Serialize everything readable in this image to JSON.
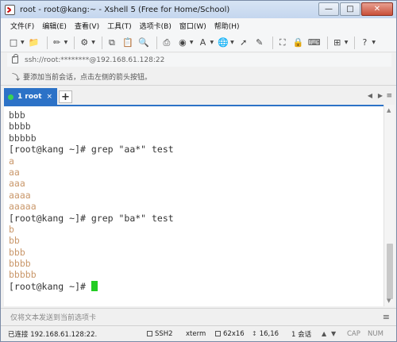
{
  "window": {
    "title": "root - root@kang:~ - Xshell 5 (Free for Home/School)",
    "minimize": "—",
    "maximize": "□",
    "close": "✕"
  },
  "menu": [
    "文件(F)",
    "编辑(E)",
    "查看(V)",
    "工具(T)",
    "选项卡(B)",
    "窗口(W)",
    "帮助(H)"
  ],
  "address": {
    "text": "ssh://root:********@192.168.61.128:22"
  },
  "hint": {
    "text": "要添加当前会话，点击左侧的箭头按钮。"
  },
  "tabs": {
    "active_label": "1 root",
    "close": "×",
    "add": "+",
    "prev": "◀",
    "next": "▶",
    "menu": "≡"
  },
  "terminal": {
    "lines": [
      {
        "text": "bbb",
        "style": "default"
      },
      {
        "text": "bbbb",
        "style": "default"
      },
      {
        "text": "bbbbb",
        "style": "default"
      },
      {
        "text": "[root@kang ~]# grep \"aa*\" test",
        "style": "prompt"
      },
      {
        "text": "a",
        "style": "out"
      },
      {
        "text": "aa",
        "style": "out"
      },
      {
        "text": "aaa",
        "style": "out"
      },
      {
        "text": "aaaa",
        "style": "out"
      },
      {
        "text": "aaaaa",
        "style": "out"
      },
      {
        "text": "[root@kang ~]# grep \"ba*\" test",
        "style": "prompt"
      },
      {
        "text": "b",
        "style": "out"
      },
      {
        "text": "bb",
        "style": "out"
      },
      {
        "text": "bbb",
        "style": "out"
      },
      {
        "text": "bbbb",
        "style": "out"
      },
      {
        "text": "bbbbb",
        "style": "out"
      }
    ],
    "final_prompt": "[root@kang ~]# "
  },
  "sendbar": {
    "placeholder": "仅将文本发送到当前选项卡",
    "menu": "≡"
  },
  "status": {
    "connection": "已连接 192.168.61.128:22.",
    "protocol": "SSH2",
    "terminal_type": "xterm",
    "size": "62x16",
    "position": "16,16",
    "sessions": "1 会话",
    "up": "▲",
    "down": "▼",
    "caps": "CAP",
    "num": "NUM"
  },
  "colors": {
    "accent": "#2c72c7",
    "output": "#c9976a",
    "cursor": "#22cc22"
  }
}
